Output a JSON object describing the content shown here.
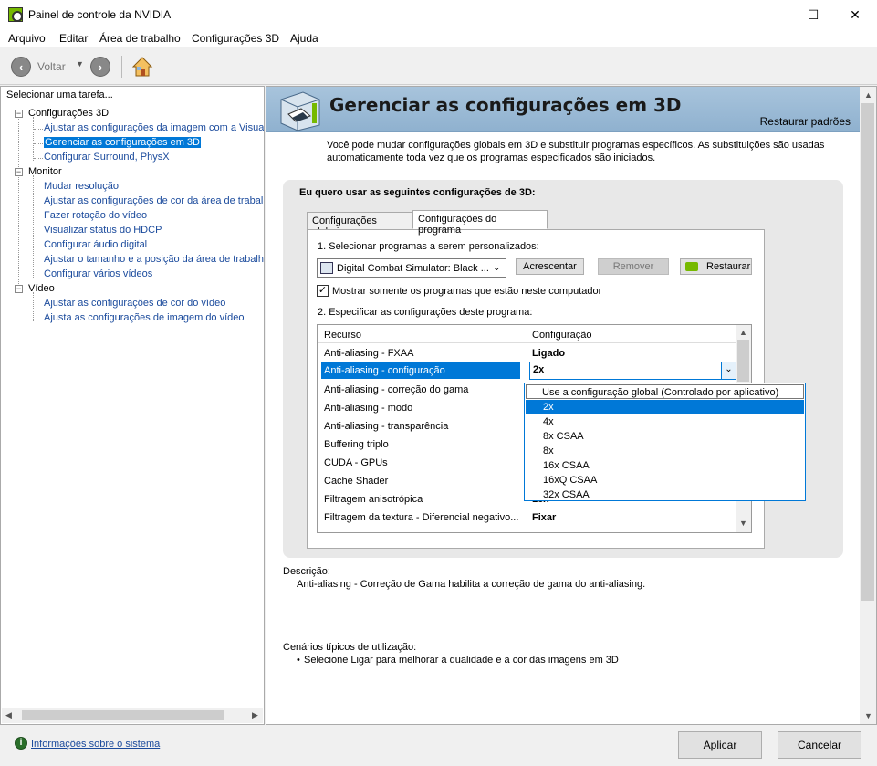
{
  "window": {
    "title": "Painel de controle da NVIDIA",
    "minimize": "—",
    "maximize": "☐",
    "close": "✕"
  },
  "menu": [
    "Arquivo",
    "Editar",
    "Área de trabalho",
    "Configurações 3D",
    "Ajuda"
  ],
  "toolbar": {
    "back_label": "Voltar",
    "back_icon": "back-arrow-icon",
    "forward_icon": "forward-arrow-icon",
    "home_icon": "home-icon"
  },
  "left": {
    "header": "Selecionar uma tarefa...",
    "groups": [
      {
        "label": "Configurações 3D",
        "items": [
          "Ajustar as configurações da imagem com a Visuali:",
          "Gerenciar as configurações em 3D",
          "Configurar Surround, PhysX"
        ],
        "selected": 1
      },
      {
        "label": "Monitor",
        "items": [
          "Mudar resolução",
          "Ajustar as configurações de cor da área de trabal",
          "Fazer rotação do vídeo",
          "Visualizar status do HDCP",
          "Configurar áudio digital",
          "Ajustar o tamanho e a posição da área de trabalh",
          "Configurar vários vídeos"
        ]
      },
      {
        "label": "Vídeo",
        "items": [
          "Ajustar as configurações de cor do vídeo",
          "Ajusta as configurações de imagem do vídeo"
        ]
      }
    ]
  },
  "main": {
    "title": "Gerenciar as configurações em 3D",
    "restore_defaults": "Restaurar padrões",
    "intro": "Você pode mudar configurações globais em 3D e substituir programas específicos. As substituições são usadas automaticamente toda vez que os programas especificados são iniciados.",
    "section_heading": "Eu quero usar as seguintes configurações de 3D:",
    "tabs": [
      "Configurações globais",
      "Configurações do programa"
    ],
    "active_tab": 1,
    "step1": "1. Selecionar programas a serem personalizados:",
    "program": "Digital Combat Simulator: Black ...",
    "add_button": "Acrescentar",
    "remove_button": "Remover",
    "restore_button": "Restaurar",
    "checkbox_label": "Mostrar somente os programas que estão neste computador",
    "checkbox_checked": true,
    "step2": "2. Especificar as configurações deste programa:",
    "grid": {
      "headers": [
        "Recurso",
        "Configuração"
      ],
      "rows": [
        [
          "Anti-aliasing - FXAA",
          "Ligado"
        ],
        [
          "Anti-aliasing - configuração",
          "2x"
        ],
        [
          "Anti-aliasing - correção do gama",
          ""
        ],
        [
          "Anti-aliasing - modo",
          ""
        ],
        [
          "Anti-aliasing - transparência",
          ""
        ],
        [
          "Buffering triplo",
          ""
        ],
        [
          "CUDA - GPUs",
          ""
        ],
        [
          "Cache Shader",
          ""
        ],
        [
          "Filtragem anisotrópica",
          "16x"
        ],
        [
          "Filtragem da textura - Diferencial negativo...",
          "Fixar"
        ]
      ],
      "selected_row": 1
    },
    "dropdown": {
      "options": [
        "Use a configuração global (Controlado por aplicativo)",
        "2x",
        "4x",
        "8x CSAA",
        "8x",
        "16x CSAA",
        "16xQ CSAA",
        "32x CSAA"
      ],
      "highlighted": 1
    },
    "description_label": "Descrição:",
    "description_text": "Anti-aliasing - Correção de Gama habilita a correção de gama do anti-aliasing.",
    "usage_label": "Cenários típicos de utilização:",
    "usage_items": [
      "Selecione Ligar para melhorar a qualidade e a cor das imagens em 3D"
    ]
  },
  "footer": {
    "sysinfo": "Informações sobre o sistema",
    "apply": "Aplicar",
    "cancel": "Cancelar"
  },
  "colors": {
    "accent": "#0078d7",
    "nvidia_green": "#76b900",
    "link": "#1a4a9c",
    "banner": "#a8c4dc"
  }
}
